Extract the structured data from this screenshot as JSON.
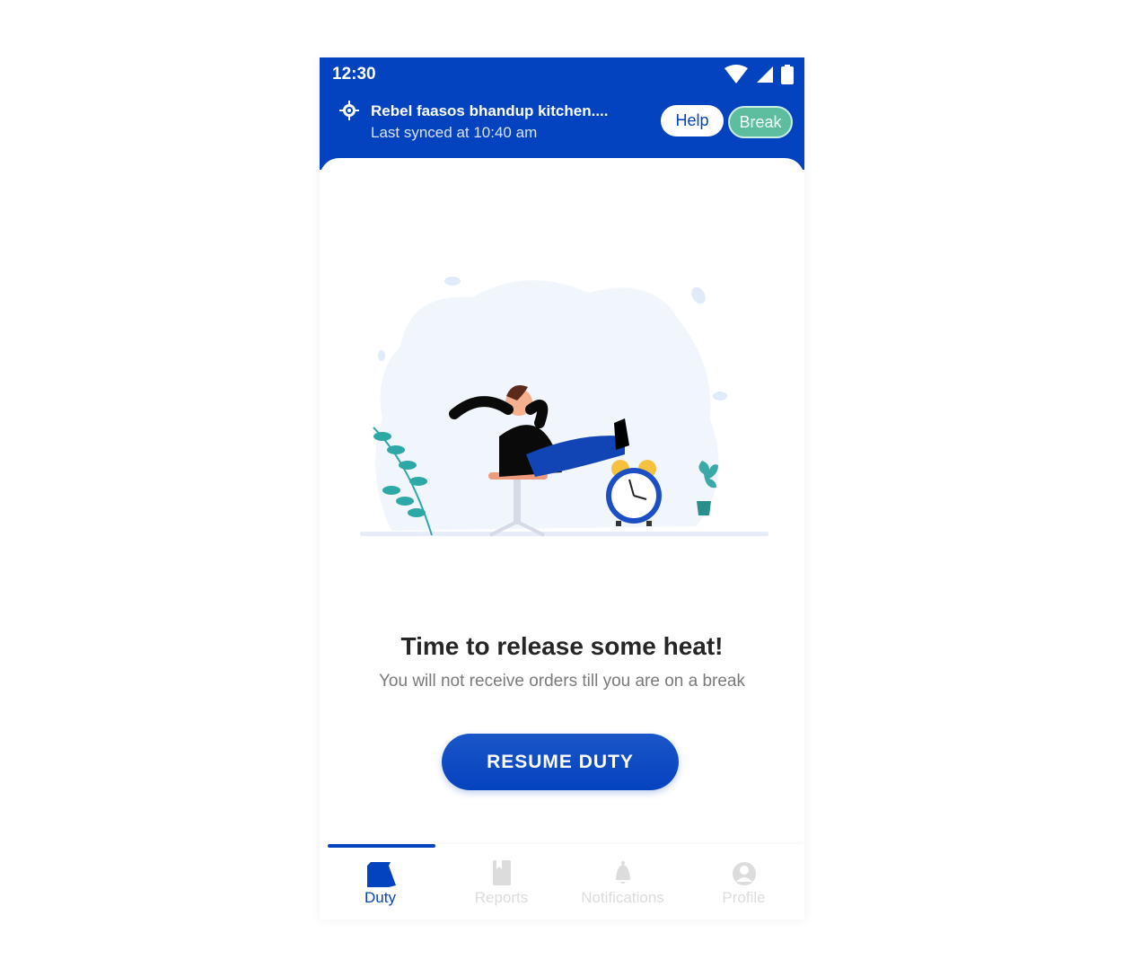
{
  "status_bar": {
    "time": "12:30",
    "icons": [
      "wifi-icon",
      "signal-icon",
      "battery-icon"
    ]
  },
  "header": {
    "location_icon": "location-target-icon",
    "title": "Rebel faasos bhandup kitchen....",
    "subtitle": "Last synced at 10:40 am",
    "help_label": "Help",
    "break_label": "Break"
  },
  "colors": {
    "primary": "#0443bf",
    "break": "#5cbd9f",
    "inactive": "#dcdcdc"
  },
  "main": {
    "illustration": "man-relaxing-with-alarm-clock",
    "heading": "Time to release some heat!",
    "subtext": "You will not receive orders till you are on a break",
    "resume_label": "RESUME DUTY"
  },
  "bottom_nav": {
    "active": "Duty",
    "items": [
      {
        "label": "Duty",
        "icon": "bag-icon"
      },
      {
        "label": "Reports",
        "icon": "book-icon"
      },
      {
        "label": "Notifications",
        "icon": "bell-icon"
      },
      {
        "label": "Profile",
        "icon": "user-icon"
      }
    ]
  }
}
